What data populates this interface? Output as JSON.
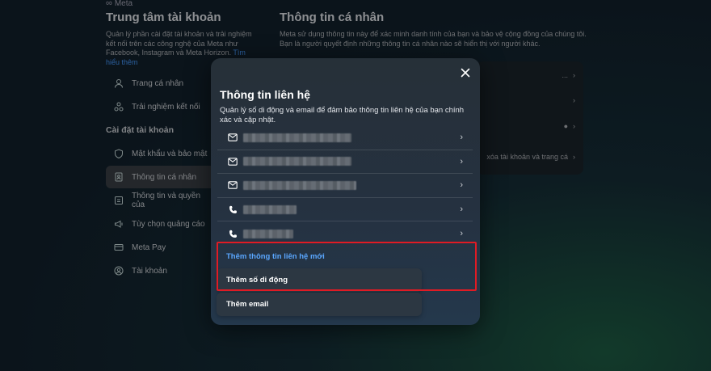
{
  "brand": {
    "name": "Meta"
  },
  "left_panel": {
    "title": "Trung tâm tài khoản",
    "description": "Quản lý phần cài đặt tài khoản và trải nghiệm kết nối trên các công nghệ của Meta như Facebook, Instagram và Meta Horizon.",
    "link": "Tìm hiểu thêm",
    "nav_top": [
      {
        "label": "Trang cá nhân",
        "icon": "profile-icon"
      },
      {
        "label": "Trải nghiệm kết nối",
        "icon": "connected-icon"
      }
    ],
    "section_label": "Cài đặt tài khoản",
    "nav_settings": [
      {
        "label": "Mật khẩu và bảo mật",
        "icon": "shield-icon"
      },
      {
        "label": "Thông tin cá nhân",
        "icon": "id-card-icon",
        "active": true
      },
      {
        "label": "Thông tin và quyền của",
        "icon": "info-icon"
      },
      {
        "label": "Tùy chọn quảng cáo",
        "icon": "megaphone-icon"
      },
      {
        "label": "Meta Pay",
        "icon": "card-icon"
      },
      {
        "label": "Tài khoản",
        "icon": "account-icon"
      }
    ]
  },
  "right_panel": {
    "title": "Thông tin cá nhân",
    "description": "Meta sử dụng thông tin này để xác minh danh tính của bạn và bảo vệ cộng đồng của chúng tôi. Bạn là người quyết định những thông tin cá nhân nào sẽ hiển thị với người khác.",
    "card_rows": [
      "...",
      "",
      "",
      "xóa tài khoản và trang cá"
    ]
  },
  "modal": {
    "title": "Thông tin liên hệ",
    "description": "Quản lý số di động và email để đảm bảo thông tin liên hệ của bạn chính xác và cập nhật.",
    "contacts": [
      {
        "type": "email",
        "icon": "mail-icon",
        "blur_width": 134
      },
      {
        "type": "email",
        "icon": "mail-icon",
        "blur_width": 134
      },
      {
        "type": "email",
        "icon": "mail-icon",
        "blur_width": 140
      },
      {
        "type": "phone",
        "icon": "phone-icon",
        "blur_width": 66
      },
      {
        "type": "phone",
        "icon": "phone-icon",
        "blur_width": 62
      }
    ],
    "add_menu": {
      "header": "Thêm thông tin liên hệ mới",
      "options": [
        "Thêm số di động",
        "Thêm email"
      ]
    }
  },
  "colors": {
    "accent": "#5aa7ff",
    "highlight": "#e01b24"
  }
}
